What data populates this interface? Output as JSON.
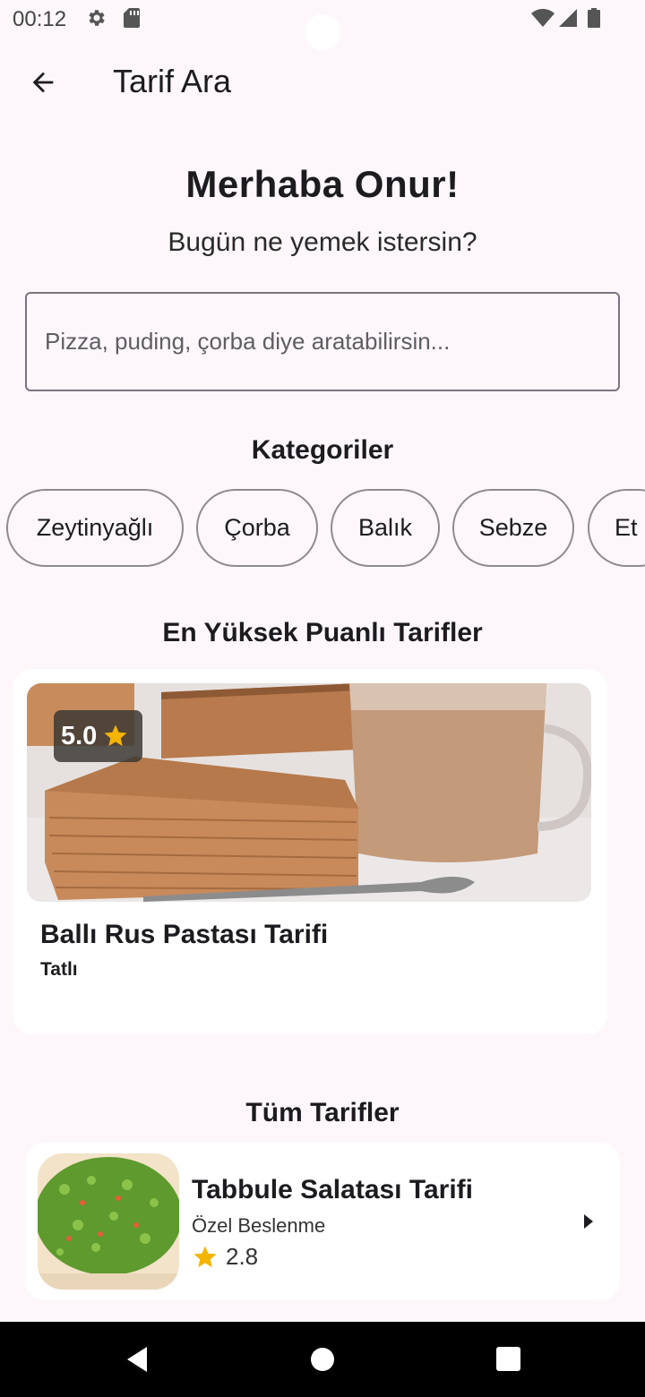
{
  "status_bar": {
    "time": "00:12",
    "icons": [
      "settings-icon",
      "sd-card-icon",
      "wifi-icon",
      "signal-icon",
      "battery-icon"
    ]
  },
  "app_bar": {
    "title": "Tarif Ara",
    "back_icon": "arrow-back-icon"
  },
  "greeting": "Merhaba Onur!",
  "subgreeting": "Bugün ne yemek istersin?",
  "search": {
    "value": "",
    "placeholder": "Pizza, puding, çorba diye aratabilirsin..."
  },
  "categories": {
    "title": "Kategoriler",
    "items": [
      {
        "label": "Zeytinyağlı"
      },
      {
        "label": "Çorba"
      },
      {
        "label": "Balık"
      },
      {
        "label": "Sebze"
      },
      {
        "label": "Et"
      }
    ]
  },
  "top_rated": {
    "title": "En Yüksek Puanlı Tarifler",
    "card": {
      "rating": "5.0",
      "name": "Ballı Rus Pastası Tarifi",
      "category": "Tatlı"
    }
  },
  "all_recipes": {
    "title": "Tüm Tarifler",
    "items": [
      {
        "name": "Tabbule Salatası Tarifi",
        "category": "Özel Beslenme",
        "rating": "2.8"
      }
    ]
  },
  "colors": {
    "background": "#fdf7fb",
    "star": "#f5b400",
    "chip_border": "#8d8a90",
    "nav_bar": "#000000"
  }
}
